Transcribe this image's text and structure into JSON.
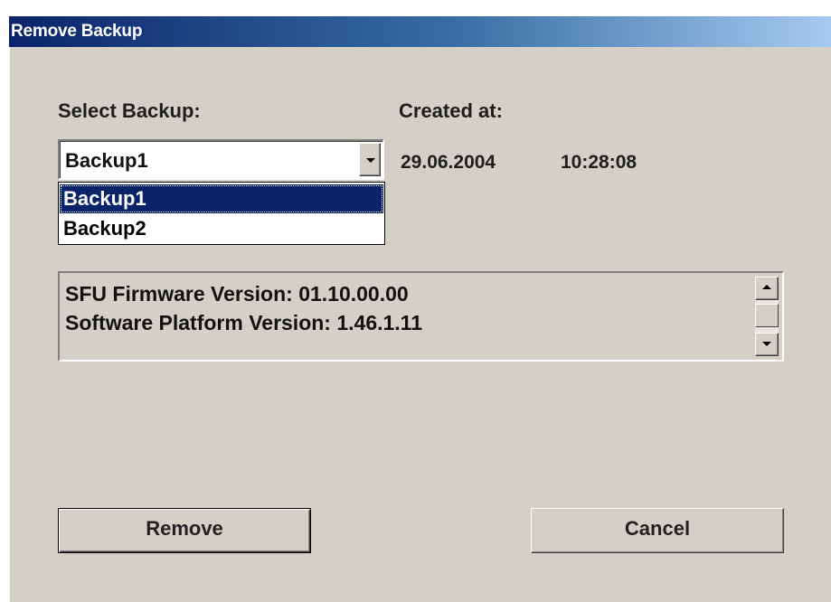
{
  "window": {
    "title": "Remove Backup"
  },
  "backup_select": {
    "label": "Select Backup:",
    "value": "Backup1",
    "options": [
      "Backup1",
      "Backup2"
    ],
    "selected_option_index": 0
  },
  "created": {
    "label": "Created at:",
    "date": "29.06.2004",
    "time": "10:28:08"
  },
  "info": {
    "lines": [
      "SFU Firmware Version: 01.10.00.00",
      "Software Platform Version: 1.46.1.11"
    ]
  },
  "buttons": {
    "remove_label": "Remove",
    "cancel_label": "Cancel"
  },
  "colors": {
    "dialog_bg": "#d4d0c8",
    "title_gradient_start": "#0a246a",
    "title_gradient_end": "#a6caf0",
    "selection": "#0a246a"
  }
}
